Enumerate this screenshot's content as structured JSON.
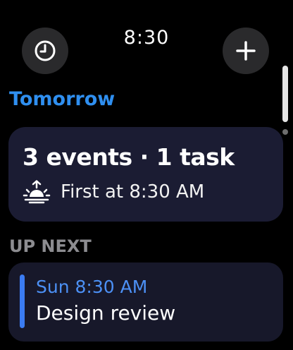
{
  "header": {
    "time": "8:30",
    "history_icon": "clock-icon",
    "add_icon": "plus-icon"
  },
  "summary": {
    "section_label": "Tomorrow",
    "title": "3 events · 1 task",
    "first_label": "First at 8:30 AM",
    "sunrise_icon": "sunrise-icon"
  },
  "up_next": {
    "section_label": "UP NEXT",
    "event": {
      "time": "Sun 8:30 AM",
      "title": "Design review"
    }
  },
  "colors": {
    "accent_blue": "#2f8ff0",
    "event_bar": "#3b7cf2",
    "card_bg": "#1b1c33",
    "muted_label": "#8c8c90"
  }
}
